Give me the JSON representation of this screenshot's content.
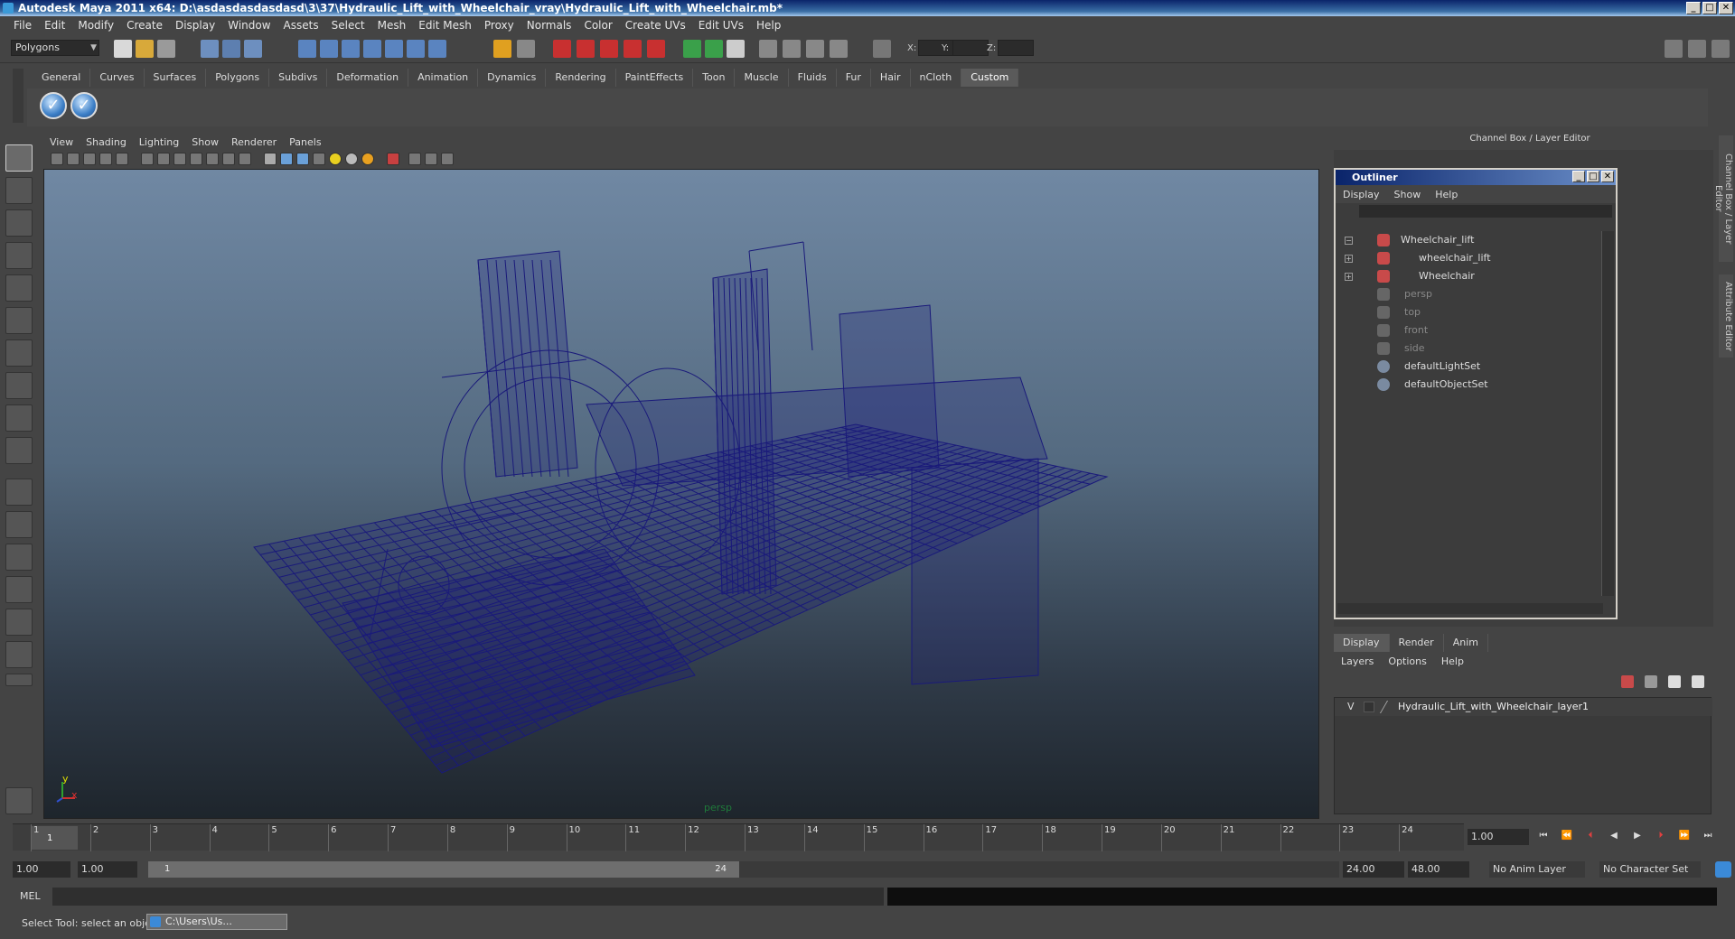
{
  "window": {
    "title": "Autodesk Maya 2011 x64: D:\\asdasdasdasdasd\\3\\37\\Hydraulic_Lift_with_Wheelchair_vray\\Hydraulic_Lift_with_Wheelchair.mb*",
    "min_label": "_",
    "max_label": "□",
    "close_label": "✕"
  },
  "menubar": [
    "File",
    "Edit",
    "Modify",
    "Create",
    "Display",
    "Window",
    "Assets",
    "Select",
    "Mesh",
    "Edit Mesh",
    "Proxy",
    "Normals",
    "Color",
    "Create UVs",
    "Edit UVs",
    "Help"
  ],
  "statusline": {
    "mode_dropdown": "Polygons",
    "x_label": "X:",
    "y_label": "Y:",
    "z_label": "Z:"
  },
  "shelf": {
    "tabs": [
      "General",
      "Curves",
      "Surfaces",
      "Polygons",
      "Subdivs",
      "Deformation",
      "Animation",
      "Dynamics",
      "Rendering",
      "PaintEffects",
      "Toon",
      "Muscle",
      "Fluids",
      "Fur",
      "Hair",
      "nCloth",
      "Custom"
    ],
    "active_tab": "Custom",
    "icon_glyph": "✓"
  },
  "viewport": {
    "menus": [
      "View",
      "Shading",
      "Lighting",
      "Show",
      "Renderer",
      "Panels"
    ],
    "camera_label": "persp",
    "axis_y": "y",
    "axis_x": "x",
    "wire_color": "#1a1a7a"
  },
  "right_panel": {
    "header": "Channel Box / Layer Editor",
    "side_tab_1": "Channel Box / Layer Editor",
    "side_tab_2": "Attribute Editor"
  },
  "outliner": {
    "title": "Outliner",
    "menus": [
      "Display",
      "Show",
      "Help"
    ],
    "items": [
      {
        "label": "Wheelchair_lift",
        "dim": false,
        "expander": "−"
      },
      {
        "label": "wheelchair_lift",
        "dim": false,
        "expander": "+"
      },
      {
        "label": "Wheelchair",
        "dim": false,
        "expander": "+"
      },
      {
        "label": "persp",
        "dim": true,
        "expander": ""
      },
      {
        "label": "top",
        "dim": true,
        "expander": ""
      },
      {
        "label": "front",
        "dim": true,
        "expander": ""
      },
      {
        "label": "side",
        "dim": true,
        "expander": ""
      },
      {
        "label": "defaultLightSet",
        "dim": false,
        "expander": ""
      },
      {
        "label": "defaultObjectSet",
        "dim": false,
        "expander": ""
      }
    ]
  },
  "layer_editor": {
    "tabs": [
      "Display",
      "Render",
      "Anim"
    ],
    "active_tab": "Display",
    "menus": [
      "Layers",
      "Options",
      "Help"
    ],
    "layer_visible": "V",
    "layer_name": "Hydraulic_Lift_with_Wheelchair_layer1"
  },
  "timeline": {
    "frames": [
      "1",
      "2",
      "3",
      "4",
      "5",
      "6",
      "7",
      "8",
      "9",
      "10",
      "11",
      "12",
      "13",
      "14",
      "15",
      "16",
      "17",
      "18",
      "19",
      "20",
      "21",
      "22",
      "23",
      "24"
    ],
    "current_frame": "1.00",
    "playhead_label": "1"
  },
  "range": {
    "start": "1.00",
    "inner_start": "1.00",
    "slider_start": "1",
    "slider_end": "24",
    "end": "24.00",
    "outer_end": "48.00",
    "anim_layer": "No Anim Layer",
    "character_set": "No Character Set"
  },
  "command": {
    "label": "MEL"
  },
  "helpline": {
    "text": "Select Tool: select an object",
    "task_item": "C:\\Users\\Us..."
  }
}
